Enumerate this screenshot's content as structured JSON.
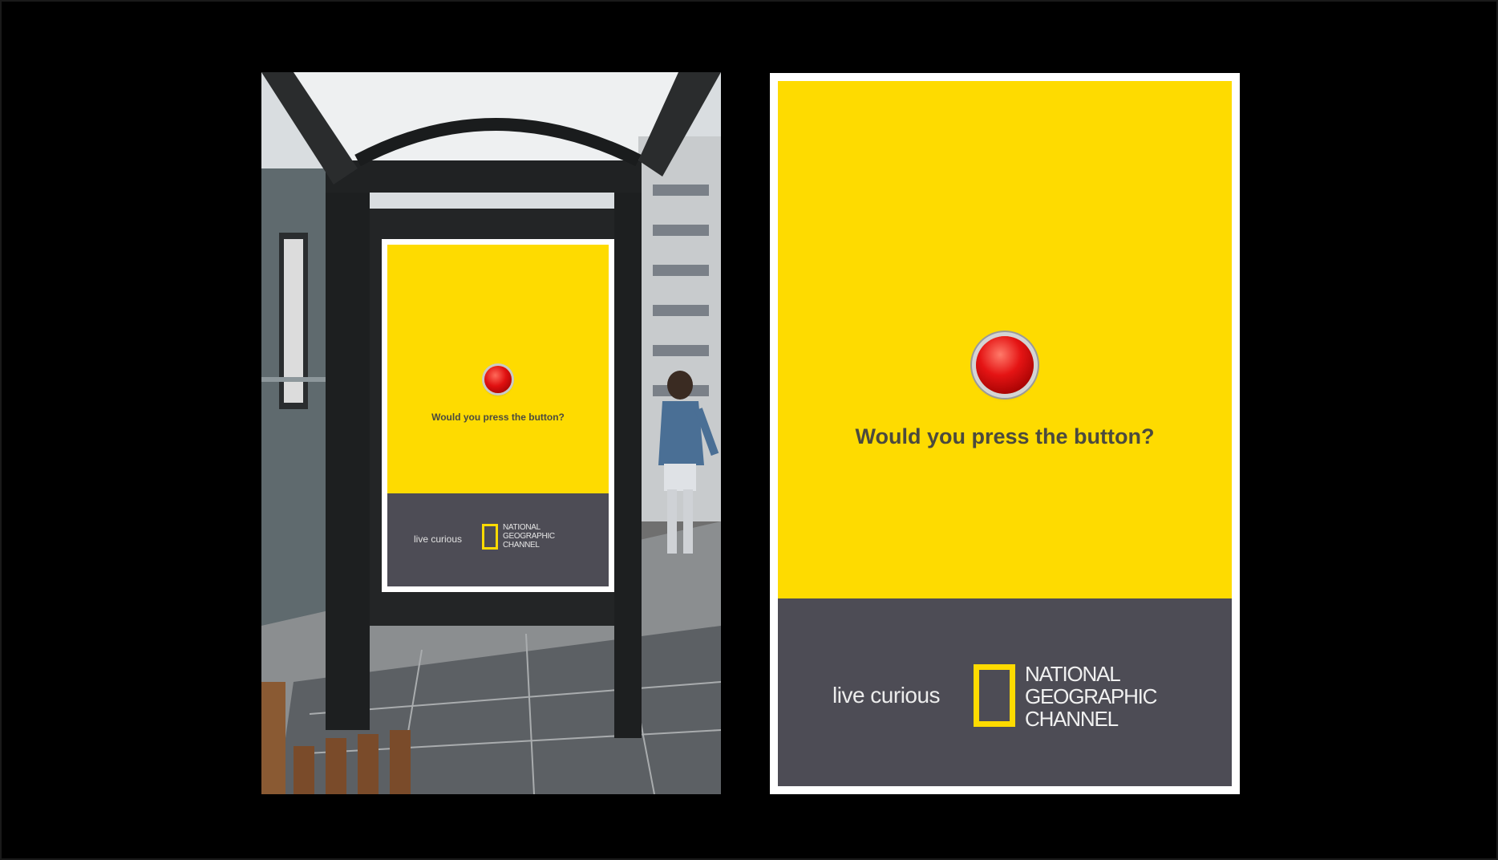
{
  "photo": {
    "subject": "bus shelter with advertisement poster"
  },
  "poster": {
    "question": "Would you press the button?",
    "tagline": "live curious",
    "logo": {
      "line1": "NATIONAL",
      "line2": "GEOGRAPHIC",
      "line3": "CHANNEL"
    }
  },
  "colors": {
    "background": "#000000",
    "poster_yellow": "#fedb00",
    "footer_gray": "#4d4c55",
    "button_red": "#e01010"
  }
}
